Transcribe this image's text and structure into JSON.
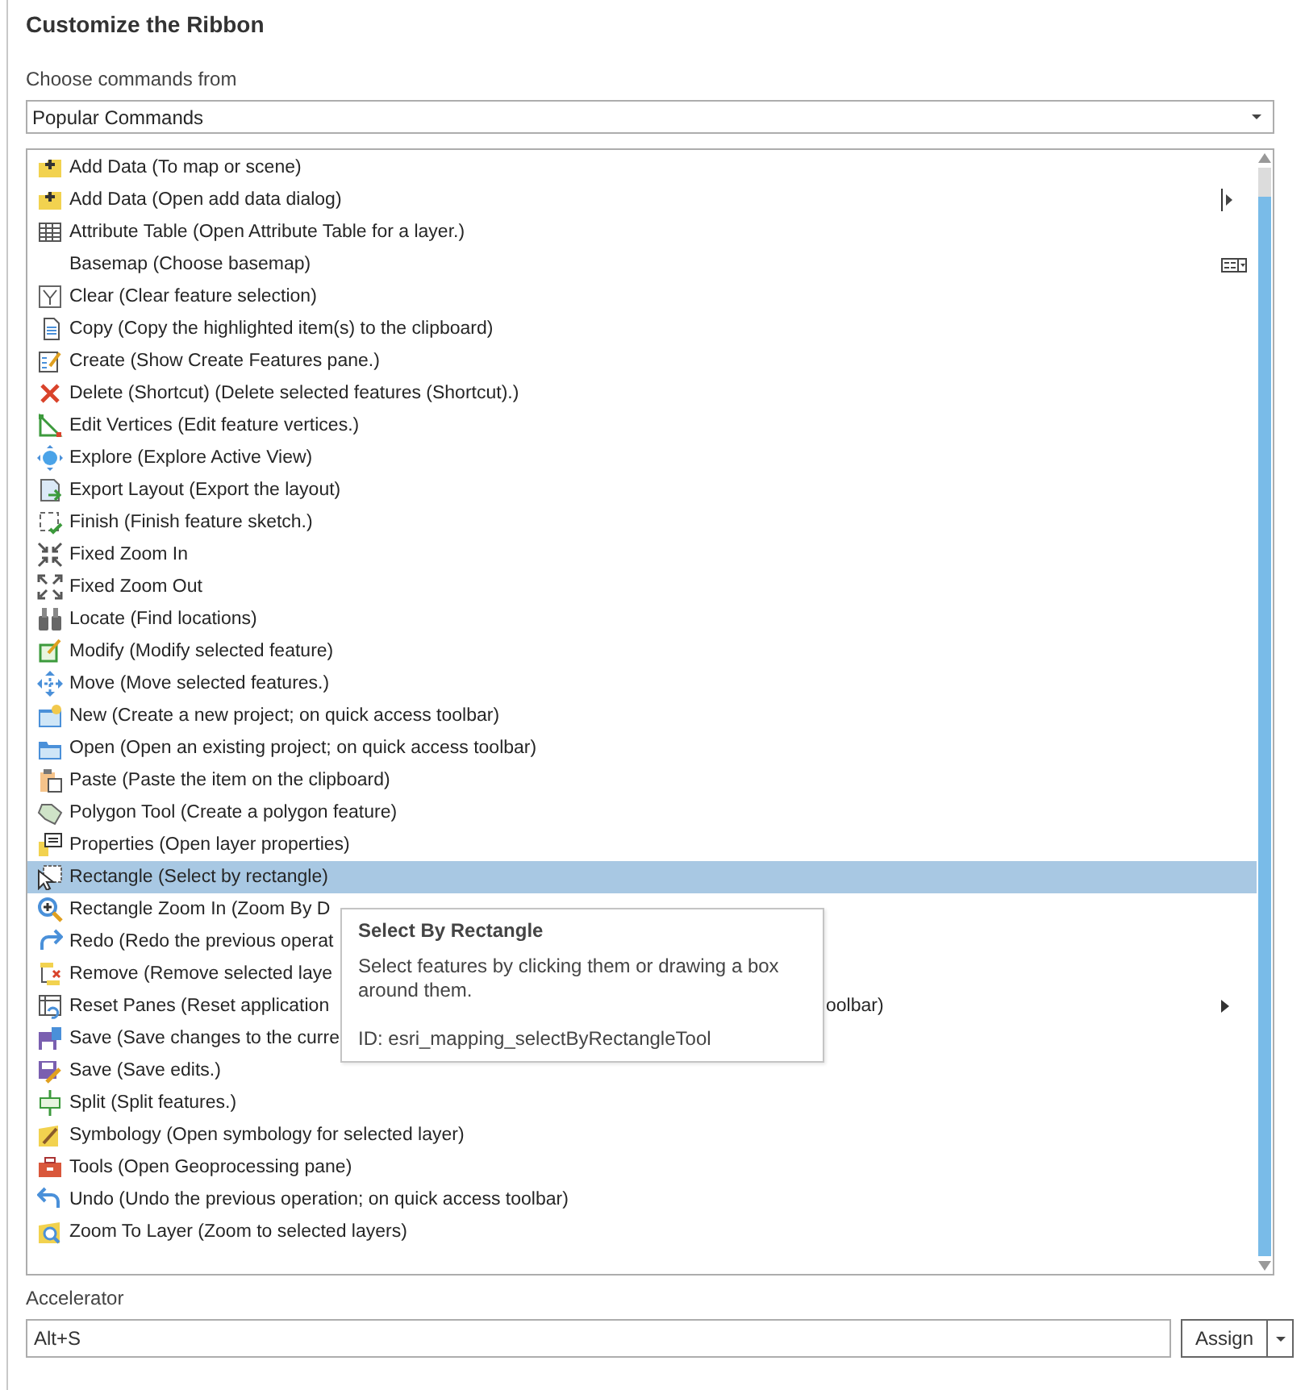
{
  "title": "Customize the Ribbon",
  "source": {
    "label": "Choose commands from",
    "value": "Popular Commands"
  },
  "commands": [
    {
      "text": "Add Data (To map or scene)",
      "kind": "button",
      "selected": false
    },
    {
      "text": "Add Data (Open add data dialog)",
      "kind": "split",
      "selected": false
    },
    {
      "text": "Attribute Table (Open Attribute Table for a layer.)",
      "kind": "button",
      "selected": false
    },
    {
      "text": "Basemap (Choose basemap)",
      "kind": "gallery",
      "selected": false
    },
    {
      "text": "Clear (Clear feature selection)",
      "kind": "button",
      "selected": false
    },
    {
      "text": "Copy (Copy the highlighted item(s) to the clipboard)",
      "kind": "button",
      "selected": false
    },
    {
      "text": "Create (Show Create Features pane.)",
      "kind": "button",
      "selected": false
    },
    {
      "text": "Delete (Shortcut) (Delete selected features (Shortcut).)",
      "kind": "button",
      "selected": false
    },
    {
      "text": "Edit Vertices (Edit feature vertices.)",
      "kind": "button",
      "selected": false
    },
    {
      "text": "Explore (Explore Active View)",
      "kind": "button",
      "selected": false
    },
    {
      "text": "Export Layout (Export the layout)",
      "kind": "button",
      "selected": false
    },
    {
      "text": "Finish (Finish feature sketch.)",
      "kind": "button",
      "selected": false
    },
    {
      "text": "Fixed Zoom In",
      "kind": "button",
      "selected": false
    },
    {
      "text": "Fixed Zoom Out",
      "kind": "button",
      "selected": false
    },
    {
      "text": "Locate (Find locations)",
      "kind": "button",
      "selected": false
    },
    {
      "text": "Modify (Modify selected feature)",
      "kind": "button",
      "selected": false
    },
    {
      "text": "Move (Move selected features.)",
      "kind": "button",
      "selected": false
    },
    {
      "text": "New (Create a new project; on quick access toolbar)",
      "kind": "button",
      "selected": false
    },
    {
      "text": "Open (Open an existing project; on quick access toolbar)",
      "kind": "button",
      "selected": false
    },
    {
      "text": "Paste (Paste the item on the clipboard)",
      "kind": "button",
      "selected": false
    },
    {
      "text": "Polygon Tool (Create a polygon feature)",
      "kind": "button",
      "selected": false
    },
    {
      "text": "Properties (Open layer properties)",
      "kind": "button",
      "selected": false
    },
    {
      "text": "Rectangle (Select by rectangle)",
      "kind": "button",
      "selected": true
    },
    {
      "text": "Rectangle Zoom In (Zoom By D",
      "kind": "button",
      "selected": false
    },
    {
      "text": "Redo (Redo the previous operat",
      "kind": "button",
      "selected": false
    },
    {
      "text": "Remove (Remove selected laye",
      "kind": "button",
      "selected": false
    },
    {
      "text": "Reset Panes (Reset application",
      "tail": "oolbar)",
      "kind": "menu",
      "selected": false
    },
    {
      "text": "Save (Save changes to the curre",
      "kind": "button",
      "selected": false
    },
    {
      "text": "Save (Save edits.)",
      "kind": "button",
      "selected": false
    },
    {
      "text": "Split (Split features.)",
      "kind": "button",
      "selected": false
    },
    {
      "text": "Symbology (Open symbology for selected layer)",
      "kind": "button",
      "selected": false
    },
    {
      "text": "Tools (Open Geoprocessing pane)",
      "kind": "button",
      "selected": false
    },
    {
      "text": "Undo (Undo the previous operation; on quick access toolbar)",
      "kind": "button",
      "selected": false
    },
    {
      "text": "Zoom To Layer (Zoom to selected layers)",
      "kind": "button",
      "selected": false
    }
  ],
  "tooltip": {
    "title": "Select By Rectangle",
    "body": "Select features by clicking them or drawing a box around them.",
    "id": "ID: esri_mapping_selectByRectangleTool"
  },
  "accelerator": {
    "label": "Accelerator",
    "value": "Alt+S",
    "button": "Assign"
  }
}
